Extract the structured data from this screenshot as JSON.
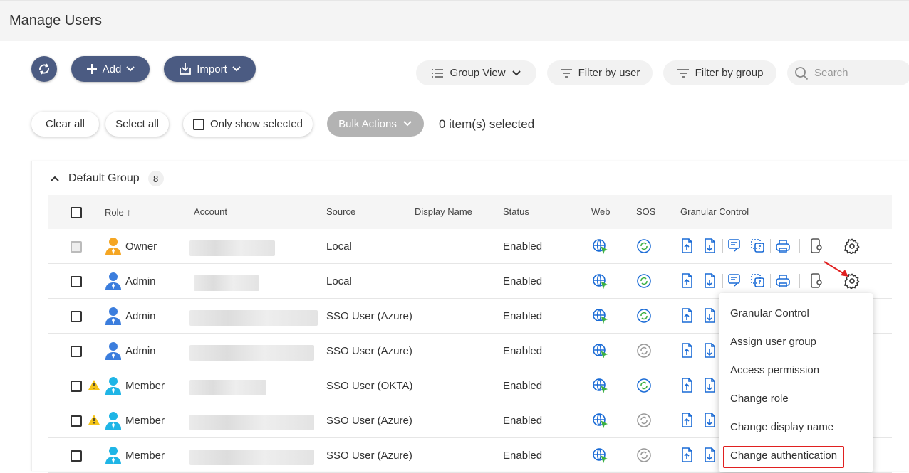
{
  "page_title": "Manage Users",
  "toolbar": {
    "add_label": "Add",
    "import_label": "Import",
    "group_view_label": "Group View",
    "filter_user_label": "Filter by user",
    "filter_group_label": "Filter by group",
    "search_placeholder": "Search"
  },
  "selection": {
    "clear_all": "Clear all",
    "select_all": "Select all",
    "only_show_selected": "Only show selected",
    "bulk_actions": "Bulk Actions",
    "count_text": "0 item(s) selected"
  },
  "group": {
    "name": "Default Group",
    "count": "8"
  },
  "columns": {
    "role": "Role",
    "account": "Account",
    "source": "Source",
    "display_name": "Display Name",
    "status": "Status",
    "web": "Web",
    "sos": "SOS",
    "granular": "Granular Control"
  },
  "rows": [
    {
      "role": "Owner",
      "source": "Local",
      "status": "Enabled",
      "warning": false,
      "sos_active": true
    },
    {
      "role": "Admin",
      "source": "Local",
      "status": "Enabled",
      "warning": false,
      "sos_active": true
    },
    {
      "role": "Admin",
      "source": "SSO User (Azure)",
      "status": "Enabled",
      "warning": false,
      "sos_active": true
    },
    {
      "role": "Admin",
      "source": "SSO User (Azure)",
      "status": "Enabled",
      "warning": false,
      "sos_active": false
    },
    {
      "role": "Member",
      "source": "SSO User (OKTA)",
      "status": "Enabled",
      "warning": true,
      "sos_active": true
    },
    {
      "role": "Member",
      "source": "SSO User (Azure)",
      "status": "Enabled",
      "warning": true,
      "sos_active": false
    },
    {
      "role": "Member",
      "source": "SSO User (Azure)",
      "status": "Enabled",
      "warning": false,
      "sos_active": false
    }
  ],
  "context_menu": {
    "items": [
      "Granular Control",
      "Assign user group",
      "Access permission",
      "Change role",
      "Change display name",
      "Change authentication"
    ],
    "highlighted": "Change authentication"
  },
  "colors": {
    "primary": "#4b5b82",
    "icon_blue": "#1a6bd6",
    "owner_orange": "#f5a623",
    "admin_blue": "#3b7ddd",
    "member_cyan": "#1fb5e6",
    "warning": "#f5c518",
    "highlight_red": "#e02020"
  }
}
